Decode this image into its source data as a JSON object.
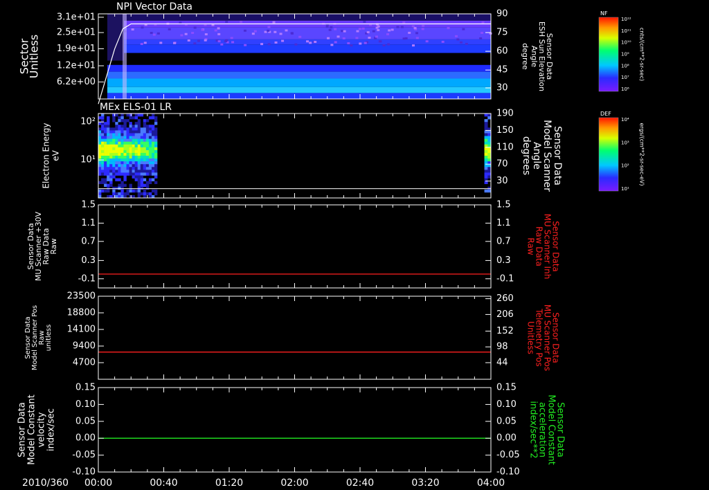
{
  "colors": {
    "white": "#ffffff",
    "red": "#ff2020",
    "green": "#22ee22"
  },
  "time_axis": {
    "date": "2010/360",
    "ticks": [
      "00:00",
      "00:40",
      "01:20",
      "02:00",
      "02:40",
      "03:20",
      "04:00"
    ]
  },
  "chart_data": [
    {
      "type": "heatmap",
      "title": "NPI Vector Data",
      "ylabel": [
        "Sector",
        "Unitless"
      ],
      "y_ticks": [
        "3.1e+01",
        "2.5e+01",
        "1.9e+01",
        "1.2e+01",
        "6.2e+00"
      ],
      "y2label": [
        "Sensor Data",
        "ESH Sun Elevation",
        "Angle",
        "degree"
      ],
      "y2_ticks": [
        "90",
        "75",
        "60",
        "45",
        "30"
      ],
      "colorbar": {
        "label": "NF",
        "units": "cnts/(cm**2-sr-sec)",
        "ticks": [
          "10¹²",
          "10¹¹",
          "10¹⁰",
          "10⁹",
          "10⁸",
          "10⁷",
          "10⁶"
        ]
      },
      "overlay_line": {
        "x": [
          "00:00",
          "00:05",
          "00:10",
          "00:15",
          "00:20",
          "00:30",
          "04:00"
        ],
        "y": [
          18,
          40,
          62,
          78,
          82,
          82,
          82
        ]
      }
    },
    {
      "type": "heatmap",
      "title": "MEx ELS-01 LR",
      "ylabel": [
        "Electron Energy",
        "eV"
      ],
      "y_ticks": [
        "10²",
        "10¹"
      ],
      "y2label": [
        "Sensor Data",
        "Model Scanner",
        "Angle",
        "degrees"
      ],
      "y2_ticks": [
        "190",
        "150",
        "110",
        "70",
        "30"
      ],
      "colorbar": {
        "label": "DEF",
        "units": "ergs/(cm**2-sr-sec-eV)",
        "ticks": [
          "10⁴",
          "10³",
          "10²",
          "10¹"
        ]
      },
      "data_intervals": [
        [
          "00:00",
          "00:36"
        ],
        [
          "03:56",
          "04:00"
        ]
      ]
    },
    {
      "type": "line",
      "ylabel": [
        "Sensor Data",
        "MU Scanner +30V",
        "Raw Data",
        "Raw"
      ],
      "y_ticks": [
        "1.5",
        "1.1",
        "0.7",
        "0.3",
        "-0.1"
      ],
      "ylim": [
        -0.3,
        1.5
      ],
      "y2label": [
        "Sensor Data",
        "MU Scanner Inh",
        "Raw Data",
        "Raw"
      ],
      "y2_ticks": [
        "1.5",
        "1.1",
        "0.7",
        "0.3",
        "-0.1"
      ],
      "series": [
        {
          "color": "red",
          "x": [
            "00:00",
            "04:00"
          ],
          "values": [
            0.0,
            0.0
          ]
        }
      ]
    },
    {
      "type": "line",
      "ylabel": [
        "Sensor Data",
        "Model Scanner Pos",
        "Raw",
        "unitless"
      ],
      "y_ticks": [
        "23500",
        "18800",
        "14100",
        "9400",
        "4700"
      ],
      "ylim": [
        0,
        23500
      ],
      "y2label": [
        "Sensor Data",
        "MU Scanner Pos",
        "Telemetry Pos",
        "Unitless"
      ],
      "y2_ticks": [
        "260",
        "206",
        "152",
        "98",
        "44"
      ],
      "series": [
        {
          "color": "red",
          "x": [
            "00:00",
            "04:00"
          ],
          "values": [
            7700,
            7700
          ]
        }
      ]
    },
    {
      "type": "line",
      "ylabel": [
        "Sensor Data",
        "Model Constant",
        "velocity",
        "index/sec"
      ],
      "y_ticks": [
        "0.15",
        "0.10",
        "0.05",
        "0.00",
        "-0.05",
        "-0.10"
      ],
      "ylim": [
        -0.1,
        0.15
      ],
      "y2label": [
        "Sensor Data",
        "Model Constant",
        "acceleration",
        "index/sec**2"
      ],
      "y2_ticks": [
        "0.15",
        "0.10",
        "0.05",
        "0.00",
        "-0.05",
        "-0.10"
      ],
      "series": [
        {
          "color": "green",
          "x": [
            "00:00",
            "04:00"
          ],
          "values": [
            0.0,
            0.0
          ]
        }
      ]
    }
  ]
}
